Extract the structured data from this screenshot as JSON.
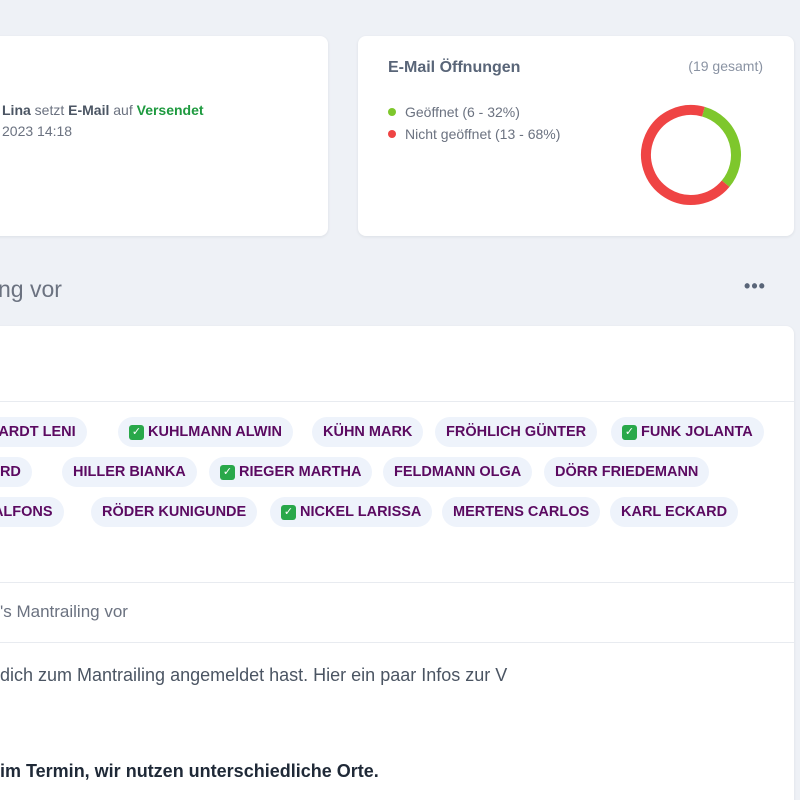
{
  "activity": {
    "user": "Lina",
    "verb": "setzt",
    "object": "E-Mail",
    "preposition": "auf",
    "status": "Versendet",
    "timestamp": "2023 14:18"
  },
  "email_opens": {
    "title": "E-Mail Öffnungen",
    "total_label": "(19 gesamt)",
    "legend_open": "Geöffnet (6 - 32%)",
    "legend_not_open": "Nicht geöffnet (13 - 68%)",
    "colors": {
      "open": "#7ec72c",
      "not_open": "#ef4444"
    }
  },
  "chart_data": {
    "type": "pie",
    "categories": [
      "Geöffnet",
      "Nicht geöffnet"
    ],
    "values": [
      6,
      13
    ],
    "percentages": [
      32,
      68
    ],
    "total": 19
  },
  "section": {
    "title": "ng vor",
    "more_icon": "more-horizontal-icon",
    "more_label": "•••"
  },
  "recipients": [
    {
      "name": "LHARDT LENI",
      "checked": false
    },
    {
      "name": "KUHLMANN ALWIN",
      "checked": true
    },
    {
      "name": "KÜHN MARK",
      "checked": false
    },
    {
      "name": "FRÖHLICH GÜNTER",
      "checked": false
    },
    {
      "name": "FUNK JOLANTA",
      "checked": true
    },
    {
      "name": "HARD",
      "checked": false
    },
    {
      "name": "HILLER BIANKA",
      "checked": false
    },
    {
      "name": "RIEGER MARTHA",
      "checked": true
    },
    {
      "name": "FELDMANN OLGA",
      "checked": false
    },
    {
      "name": "DÖRR FRIEDEMANN",
      "checked": false
    },
    {
      "name": "N ALFONS",
      "checked": false
    },
    {
      "name": "RÖDER KUNIGUNDE",
      "checked": false
    },
    {
      "name": "NICKEL LARISSA",
      "checked": true
    },
    {
      "name": "MERTENS CARLOS",
      "checked": false
    },
    {
      "name": "KARL ECKARD",
      "checked": false
    }
  ],
  "check_glyph": "✓",
  "mail": {
    "subject": "'s Mantrailing vor",
    "body_line1": "dich zum Mantrailing angemeldet hast. Hier ein paar Infos zur V",
    "body_line2": "im Termin, wir nutzen unterschiedliche Orte."
  }
}
